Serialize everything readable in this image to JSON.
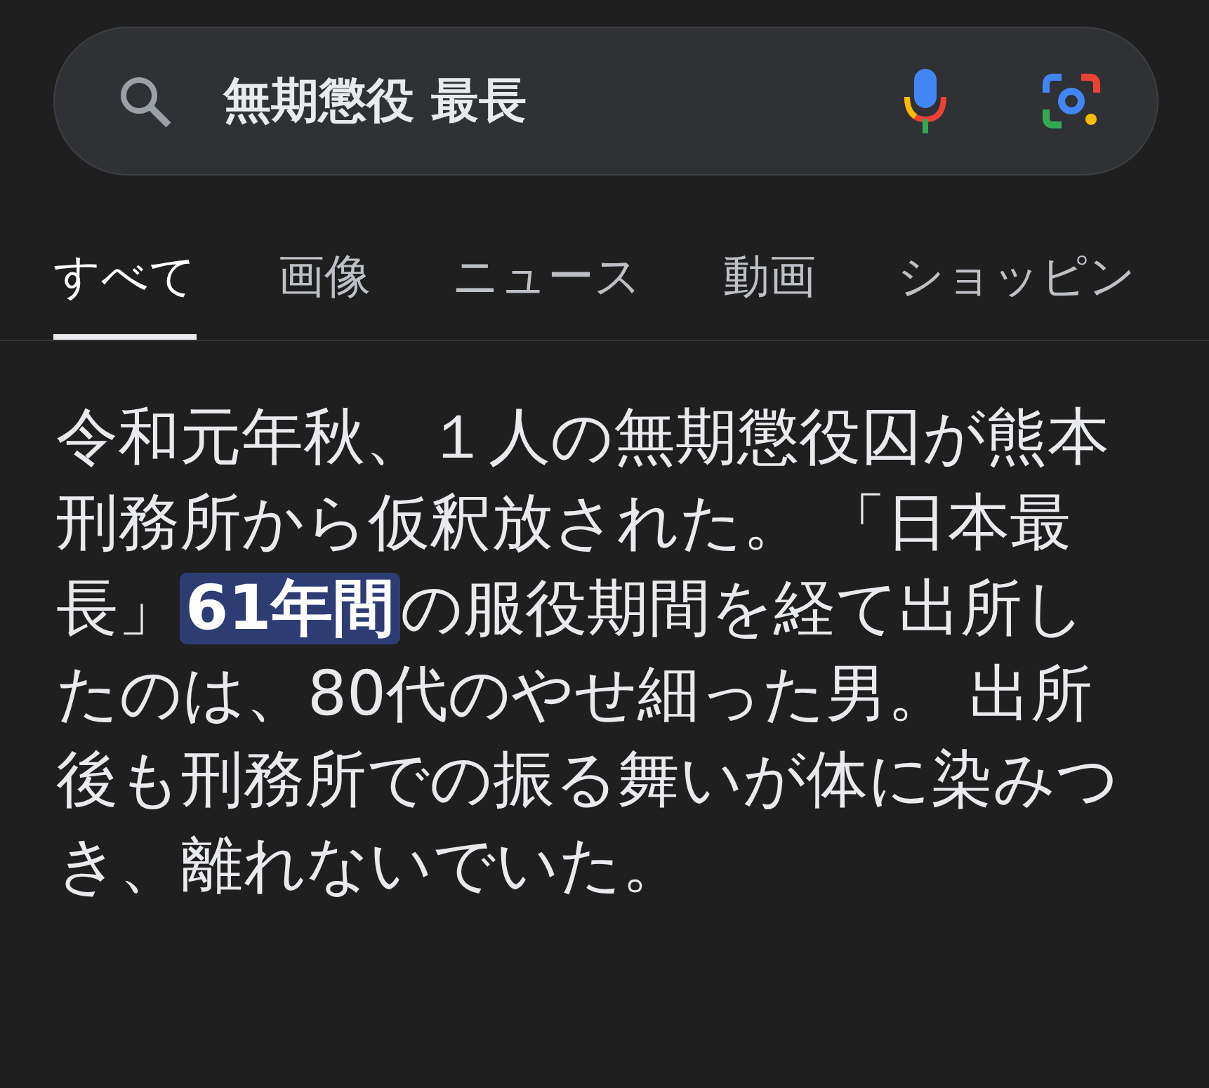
{
  "search": {
    "value": "無期懲役 最長"
  },
  "tabs": [
    {
      "label": "すべて",
      "selected": true
    },
    {
      "label": "画像",
      "selected": false
    },
    {
      "label": "ニュース",
      "selected": false
    },
    {
      "label": "動画",
      "selected": false
    },
    {
      "label": "ショッピン",
      "selected": false
    }
  ],
  "snippet": {
    "text": "令和元年秋、１人の無期懲役囚が熊本刑務所から仮釈放された。 「日本最長」**61年間**の服役期間を経て出所したのは、80代のやせ細った男。 出所後も刑務所での振る舞いが体に染みつき、離れないでいた。"
  }
}
